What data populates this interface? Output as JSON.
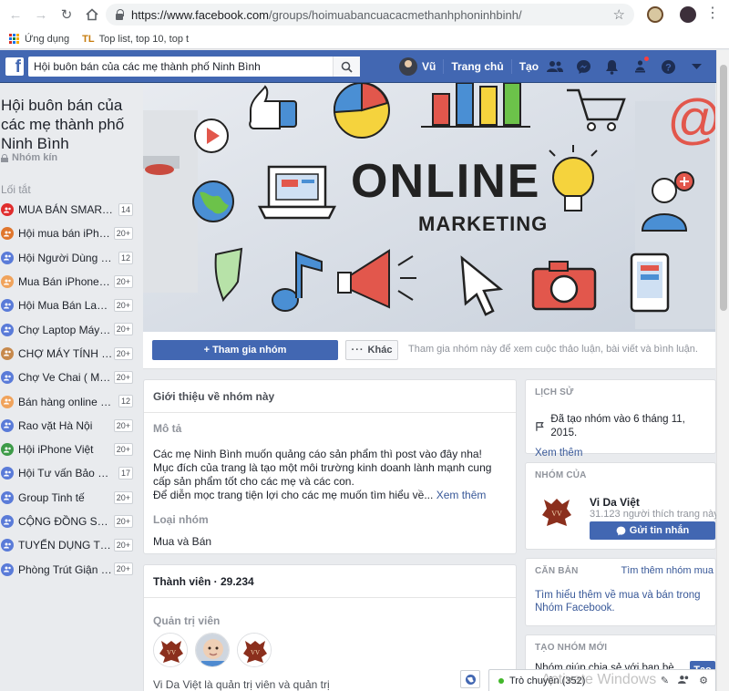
{
  "browser": {
    "url_host": "https://www.facebook.com",
    "url_path": "/groups/hoimuabancuacacmethanhphoninhbinh/",
    "bookmarks": [
      {
        "label": "Ứng dụng",
        "icon": "apps-grid-icon"
      },
      {
        "label": "Top list, top 10, top t",
        "icon": "tl-icon",
        "badge": "TL"
      }
    ]
  },
  "fb_header": {
    "search_value": "Hội buôn bán của các mẹ thành phố Ninh Bình",
    "user_name": "Vũ",
    "home_label": "Trang chủ",
    "create_label": "Tạo",
    "icons": [
      "friends-icon",
      "messenger-icon",
      "notifications-icon",
      "groups-icon",
      "help-icon",
      "dropdown-caret-icon"
    ]
  },
  "sidebar": {
    "group_name": "Hội buôn bán của các mẹ thành phố Ninh Bình",
    "privacy": "Nhóm kín",
    "shortcuts_title": "Lối tắt",
    "shortcuts": [
      {
        "label": "MUA BÁN SMARTP...",
        "count": "14",
        "color": "#e02d2d"
      },
      {
        "label": "Hội mua bán iPhon...",
        "count": "20+",
        "color": "#e0762d"
      },
      {
        "label": "Hội Người Dùng Sả...",
        "count": "12",
        "color": "#5a7bd8"
      },
      {
        "label": "Mua Bán iPhone C...",
        "count": "20+",
        "color": "#f0a35c"
      },
      {
        "label": "Hội Mua Bán Lapto...",
        "count": "20+",
        "color": "#5a7bd8"
      },
      {
        "label": "Chợ Laptop Máy Tí...",
        "count": "20+",
        "color": "#5a7bd8"
      },
      {
        "label": "CHỢ MÁY TÍNH - ...",
        "count": "20+",
        "color": "#c7894c"
      },
      {
        "label": "Chợ Ve Chai ( Mua...",
        "count": "20+",
        "color": "#5a7bd8"
      },
      {
        "label": "Bán hàng online tốt ...",
        "count": "12",
        "color": "#f0a35c"
      },
      {
        "label": "Rao vặt Hà Nội",
        "count": "20+",
        "color": "#5a7bd8"
      },
      {
        "label": "Hội iPhone Việt",
        "count": "20+",
        "color": "#3d9b48"
      },
      {
        "label": "Hội Tư vấn Bảo hiể...",
        "count": "17",
        "color": "#5a7bd8"
      },
      {
        "label": "Group Tinh tế",
        "count": "20+",
        "color": "#5a7bd8"
      },
      {
        "label": "CỘNG ĐỒNG SH ...",
        "count": "20+",
        "color": "#5a7bd8"
      },
      {
        "label": "TUYỂN DỤNG TÌM...",
        "count": "20+",
        "color": "#5a7bd8"
      },
      {
        "label": "Phòng Trút Giận - ...",
        "count": "20+",
        "color": "#5a7bd8"
      }
    ]
  },
  "cover": {
    "headline": "ONLINE",
    "subline": "MARKETING"
  },
  "actions": {
    "join_label": "+ Tham gia nhóm",
    "more_label": "Khác",
    "hint": "Tham gia nhóm này để xem cuộc thảo luận, bài viết và bình luận."
  },
  "about": {
    "title": "Giới thiệu về nhóm này",
    "desc_label": "Mô tả",
    "desc_lines": [
      "Các mẹ Ninh Bình muốn quảng cáo sản phẩm thì post vào đây nha!",
      "Mục đích của trang là tạo một môi trường kinh doanh lành mạnh cung cấp sản phẩm tốt cho các mẹ và các con.",
      "Để diễn mọc trang tiện lợi cho các mẹ muốn tìm hiểu về..."
    ],
    "see_more": "Xem thêm",
    "type_label": "Loại nhóm",
    "type_value": "Mua và Bán"
  },
  "members": {
    "title": "Thành viên · 29.234",
    "admins_label": "Quản trị viên",
    "footer_partial": "Vi Da Việt là quản trị viên và quản trị"
  },
  "history": {
    "title": "LỊCH SỬ",
    "created": "Đã tạo nhóm vào 6 tháng 11, 2015.",
    "see_more": "Xem thêm"
  },
  "owner": {
    "title": "NHÓM CỦA",
    "name": "Vi Da Việt",
    "likes": "31.123 người thích trang này",
    "message_label": "Gửi tin nhắn"
  },
  "basics": {
    "title": "CĂN BẢN",
    "find_more": "Tìm thêm nhóm mua",
    "learn_more": "Tìm hiểu thêm về mua và bán trong Nhóm Facebook."
  },
  "create_group": {
    "title": "TẠO NHÓM MỚI",
    "text": "Nhóm giúp chia sẻ với bạn bè,",
    "button": "Tạo"
  },
  "chat": {
    "label": "Trò chuyện (352)",
    "watermark": "Activate Windows"
  }
}
